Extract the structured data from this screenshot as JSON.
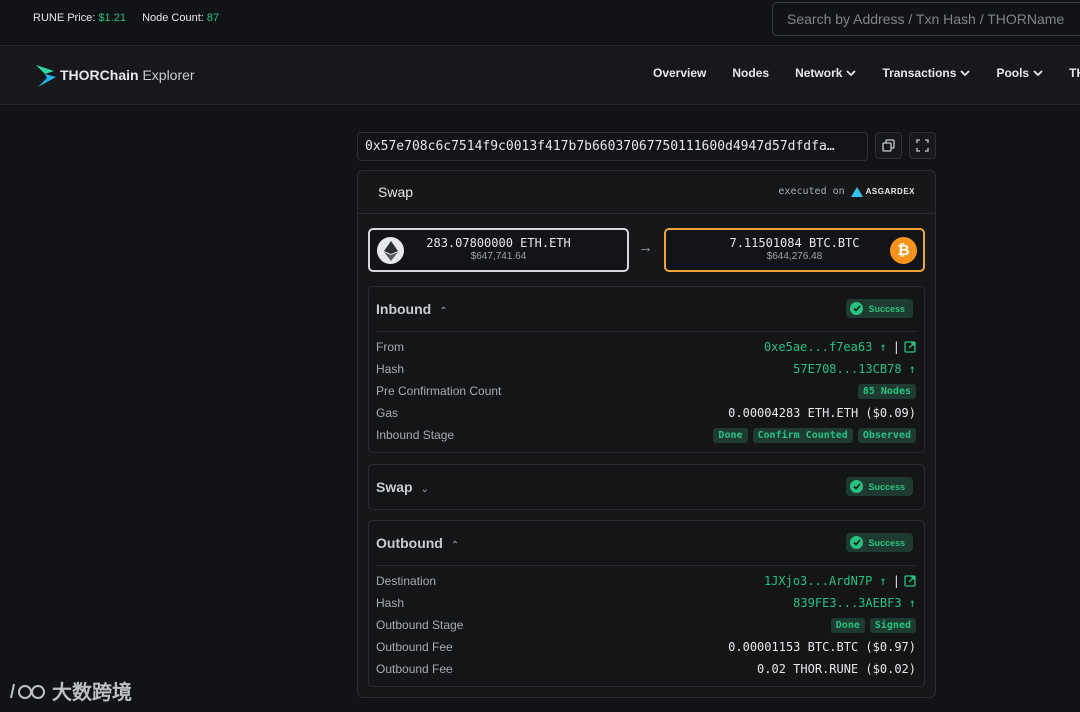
{
  "topbar": {
    "rune_label": "RUNE Price:",
    "rune_value": "$1.21",
    "node_label": "Node Count:",
    "node_value": "87",
    "search_placeholder": "Search by Address / Txn Hash / THORName"
  },
  "brand": {
    "bold": "THORChain",
    "light": " Explorer"
  },
  "nav": [
    "Overview",
    "Nodes",
    "Network",
    "Transactions",
    "Pools",
    "THO"
  ],
  "tx_hash": "0x57e708c6c7514f9c0013f417b7b66037067750111600d4947d57dfdfa…",
  "card": {
    "title": "Swap",
    "executed_on": "executed on",
    "dex": "ASGARDEX",
    "from_asset": {
      "amount": "283.07800000 ETH.ETH",
      "usd": "$647,741.64",
      "icon": "eth-icon"
    },
    "to_asset": {
      "amount": "7.11501084 BTC.BTC",
      "usd": "$644,276.48",
      "icon": "btc-icon"
    },
    "arrow": "→"
  },
  "status_label": "Success",
  "inbound": {
    "title": "Inbound",
    "caret": "^",
    "rows": {
      "from_k": "From",
      "from_v": "0xe5ae...f7ea63 ↑",
      "hash_k": "Hash",
      "hash_v": "57E708...13CB78 ↑",
      "precount_k": "Pre Confirmation Count",
      "precount_v": "85 Nodes",
      "gas_k": "Gas",
      "gas_v": "0.00004283 ETH.ETH ($0.09)",
      "stage_k": "Inbound Stage",
      "stage_tags": [
        "Done",
        "Confirm Counted",
        "Observed"
      ]
    }
  },
  "swap": {
    "title": "Swap",
    "caret": "v"
  },
  "outbound": {
    "title": "Outbound",
    "caret": "^",
    "rows": {
      "dest_k": "Destination",
      "dest_v": "1JXjo3...ArdN7P ↑",
      "hash_k": "Hash",
      "hash_v": "839FE3...3AEBF3 ↑",
      "stage_k": "Outbound Stage",
      "stage_tags": [
        "Done",
        "Signed"
      ],
      "fee1_k": "Outbound Fee",
      "fee1_v": "0.00001153 BTC.BTC ($0.97)",
      "fee2_k": "Outbound Fee",
      "fee2_v": "0.02 THOR.RUNE ($0.02)"
    }
  },
  "watermark": "大数跨境"
}
